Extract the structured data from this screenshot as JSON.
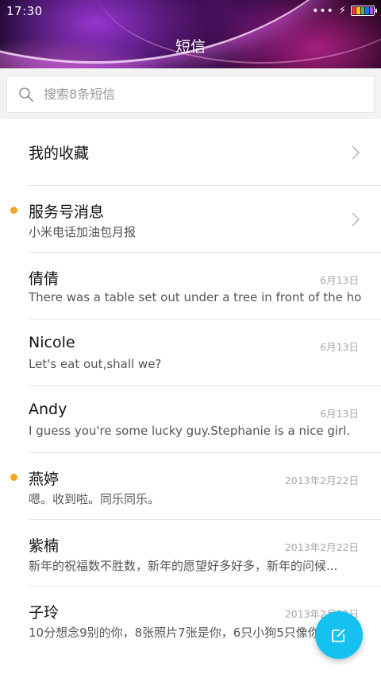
{
  "status_bar": {
    "time": "17:30",
    "dots": "•••",
    "bolt": "⚡",
    "battery_colors": [
      "#ff3b30",
      "#ffcc00",
      "#34c759",
      "#007aff",
      "#af52de"
    ]
  },
  "header": {
    "title": "短信"
  },
  "search": {
    "placeholder": "搜索8条短信",
    "value": ""
  },
  "favorites": {
    "label": "我的收藏"
  },
  "service": {
    "title": "服务号消息",
    "preview": "小米电话加油包月报",
    "unread": true
  },
  "conversations": [
    {
      "name": "倩倩",
      "preview": "There was a table set out under a tree in front of the ho...",
      "date": "6月13日",
      "unread": false
    },
    {
      "name": "Nicole",
      "preview": "Let's eat out,shall we?",
      "date": "6月13日",
      "unread": false
    },
    {
      "name": "Andy",
      "preview": "I guess you're some lucky guy.Stephanie is a nice girl.",
      "date": "6月13日",
      "unread": false
    },
    {
      "name": "燕婷",
      "preview": "嗯。收到啦。同乐同乐。",
      "date": "2013年2月22日",
      "unread": true
    },
    {
      "name": "紫楠",
      "preview": "新年的祝福数不胜数，新年的愿望好多好多，新年的问候...",
      "date": "2013年2月22日",
      "unread": false
    },
    {
      "name": "子玲",
      "preview": "10分想念9别的你，8张照片7张是你，6只小狗5只像你",
      "date": "2013年2月22日",
      "unread": false
    }
  ],
  "colors": {
    "accent": "#14c1f0",
    "unread_dot": "#f5a623"
  },
  "fab": {
    "icon": "compose-icon"
  }
}
